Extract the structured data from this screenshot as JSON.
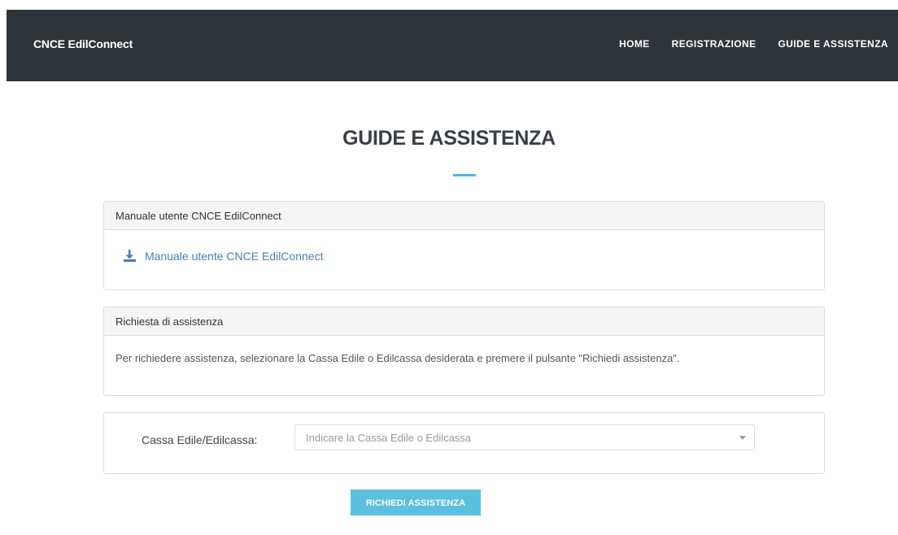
{
  "header": {
    "brand": "CNCE EdilConnect",
    "nav": [
      "HOME",
      "REGISTRAZIONE",
      "GUIDE E ASSISTENZA"
    ]
  },
  "page": {
    "title": "GUIDE E ASSISTENZA"
  },
  "manual_panel": {
    "heading": "Manuale utente CNCE EdilConnect",
    "link_label": "Manuale utente CNCE EdilConnect",
    "icon": "download-icon"
  },
  "assistance_panel": {
    "heading": "Richiesta di assistenza",
    "text": "Per richiedere assistenza, selezionare la Cassa Edile o Edilcassa desiderata e premere il pulsante \"Richiedi assistenza\"."
  },
  "select": {
    "label": "Cassa Edile/Edilcassa:",
    "placeholder": "Indicare la Cassa Edile o Edilcassa"
  },
  "button": {
    "label": "RICHIEDI ASSISTENZA"
  },
  "colors": {
    "header_bg": "#2f3439",
    "accent": "#4fb8df",
    "button_bg": "#5bc0de",
    "link": "#4a7cb0"
  }
}
